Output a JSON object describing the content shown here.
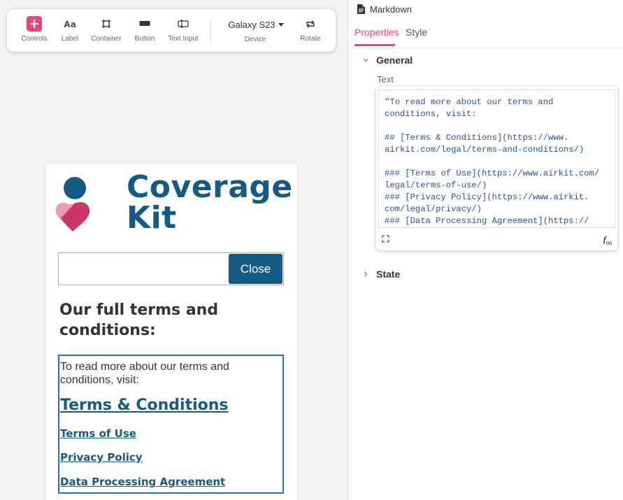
{
  "toolbar": {
    "tools": [
      {
        "label": "Controls",
        "icon": "plus-icon"
      },
      {
        "label": "Label",
        "icon": "text-aa-icon",
        "glyph": "Aa"
      },
      {
        "label": "Container",
        "icon": "container-icon"
      },
      {
        "label": "Button",
        "icon": "button-icon"
      },
      {
        "label": "Text Input",
        "icon": "text-input-icon"
      }
    ],
    "device": {
      "value": "Galaxy S23",
      "label": "Device"
    },
    "rotate": {
      "label": "Rotate",
      "icon": "rotate-icon"
    }
  },
  "preview": {
    "logo": {
      "line1": "Coverage",
      "line2": "Kit"
    },
    "input": {
      "value": ""
    },
    "close_label": "Close",
    "heading": "Our full terms and conditions:",
    "markdown": {
      "intro": "To read more about our terms and conditions, visit:",
      "links": [
        {
          "label": "Terms & Conditions",
          "level": "h2"
        },
        {
          "label": "Terms of Use",
          "level": "h3"
        },
        {
          "label": "Privacy Policy",
          "level": "h3"
        },
        {
          "label": "Data Processing Agreement",
          "level": "h3"
        }
      ]
    }
  },
  "panel": {
    "component": "Markdown",
    "tabs": [
      {
        "label": "Properties",
        "active": true
      },
      {
        "label": "Style",
        "active": false
      }
    ],
    "sections": {
      "general": "General",
      "state": "State"
    },
    "text_label": "Text",
    "text_value": "\"To read more about our terms and\nconditions, visit:\n\n## [Terms & Conditions](https://www.\nairkit.com/legal/terms-and-conditions/)\n\n### [Terms of Use](https://www.airkit.com/\nlegal/terms-of-use/)\n### [Privacy Policy](https://www.airkit.\ncom/legal/privacy/)\n### [Data Processing Agreement](https://",
    "fx_label": "f",
    "fx_sub": "(x)"
  },
  "colors": {
    "accent": "#e8457c",
    "brand": "#155a85",
    "code": "#2b4f9e"
  }
}
